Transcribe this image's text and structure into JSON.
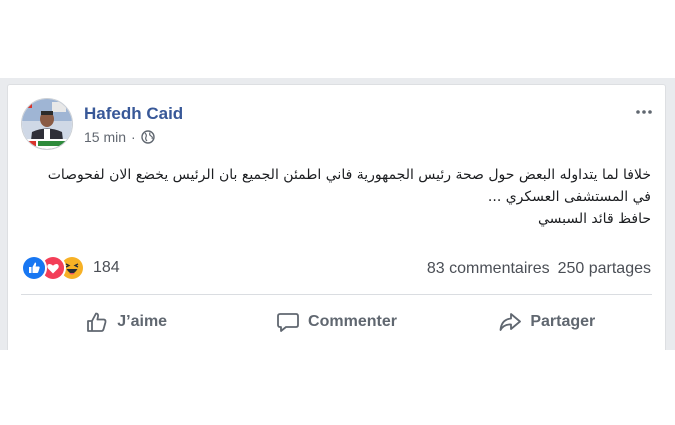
{
  "post": {
    "author": "Hafedh Caid",
    "time": "15 min",
    "separator": "·",
    "privacy_icon": "globe-icon",
    "more_icon": "more-options-icon",
    "text_lines": [
      "خلافا لما يتداوله البعض حول صحة رئيس الجمهورية فاني اطمئن الجميع بان الرئيس يخضع الان لفحوصات",
      "في المستشفى العسكري ...",
      "حافظ قائد السبسي"
    ]
  },
  "engagement": {
    "reaction_icons": [
      "like-icon",
      "love-icon",
      "haha-icon"
    ],
    "reaction_count": "184",
    "comments": "83 commentaires",
    "shares": "250 partages"
  },
  "actions": {
    "like": "J’aime",
    "comment": "Commenter",
    "share": "Partager"
  },
  "colors": {
    "author": "#385898",
    "like_blue": "#1877f2",
    "love_red": "#f33e58",
    "haha_yellow": "#f7b125",
    "text_secondary": "#606770"
  }
}
